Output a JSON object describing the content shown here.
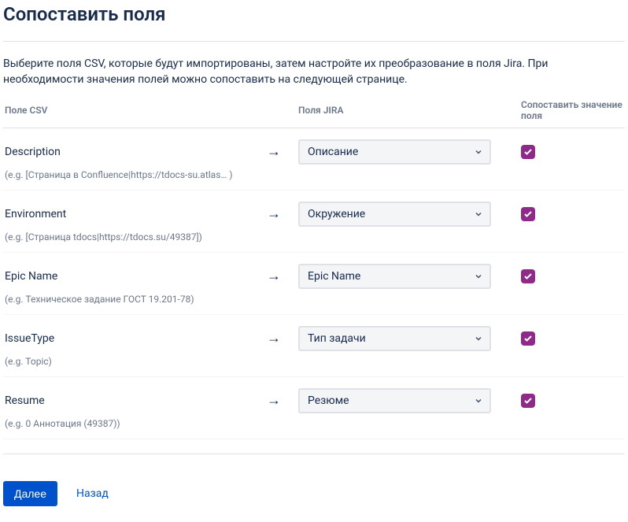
{
  "title": "Сопоставить поля",
  "intro": "Выберите поля CSV, которые будут импортированы, затем настройте их преобразование в поля Jira. При необходимости значения полей можно сопоставить на следующей странице.",
  "headers": {
    "csv": "Поле CSV",
    "jira": "Поля JIRA",
    "map": "Сопоставить значение поля"
  },
  "arrow": "→",
  "rows": [
    {
      "csv_field": "Description",
      "example": "(e.g.  [Страница в Confluence|https://tdocs-su.atlas…  )",
      "jira_field": "Описание",
      "checked": true
    },
    {
      "csv_field": "Environment",
      "example": "(e.g.  [Страница tdocs|https://tdocs.su/49387])",
      "jira_field": "Окружение",
      "checked": true
    },
    {
      "csv_field": "Epic Name",
      "example": "(e.g.  Техническое задание ГОСТ 19.201-78)",
      "jira_field": "Epic Name",
      "checked": true
    },
    {
      "csv_field": "IssueType",
      "example": "(e.g.  Topic)",
      "jira_field": "Тип задачи",
      "checked": true
    },
    {
      "csv_field": "Resume",
      "example": "(e.g.  0 Аннотация (49387))",
      "jira_field": "Резюме",
      "checked": true
    }
  ],
  "buttons": {
    "next": "Далее",
    "back": "Назад"
  }
}
